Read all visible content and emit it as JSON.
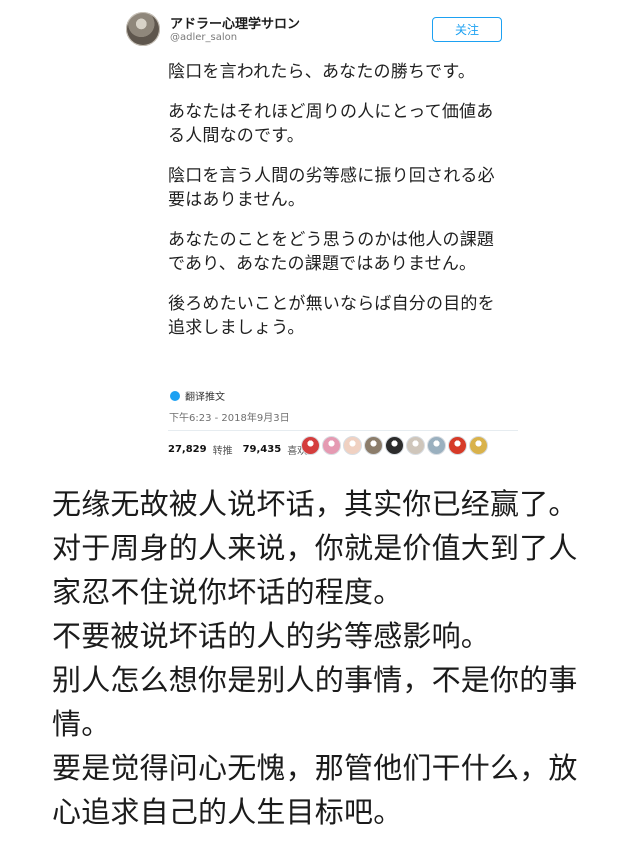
{
  "profile": {
    "display_name": "アドラー心理学サロン",
    "handle": "@adler_salon",
    "follow_label": "关注"
  },
  "tweet": {
    "paragraphs": [
      "陰口を言われたら、あなたの勝ちです。",
      "あなたはそれほど周りの人にとって価値ある人間なのです。",
      "陰口を言う人間の劣等感に振り回される必要はありません。",
      "あなたのことをどう思うのかは他人の課題であり、あなたの課題ではありません。",
      "後ろめたいことが無いならば自分の目的を追求しましょう。"
    ],
    "translate_label": "翻译推文",
    "timestamp": "下午6:23 - 2018年9月3日"
  },
  "stats": {
    "retweets_count": "27,829",
    "retweets_label": "转推",
    "likes_count": "79,435",
    "likes_label": "喜欢"
  },
  "liker_avatars": [
    {
      "icon": "liker-avatar-icon",
      "color": "#d43d3d"
    },
    {
      "icon": "liker-avatar-icon",
      "color": "#e59ab2"
    },
    {
      "icon": "liker-avatar-icon",
      "color": "#f0d1c2"
    },
    {
      "icon": "liker-avatar-icon",
      "color": "#8c7d6b"
    },
    {
      "icon": "liker-avatar-icon",
      "color": "#2b2b2b"
    },
    {
      "icon": "liker-avatar-icon",
      "color": "#cfc6bb"
    },
    {
      "icon": "liker-avatar-icon",
      "color": "#9ab0bf"
    },
    {
      "icon": "liker-avatar-icon",
      "color": "#d63a28"
    },
    {
      "icon": "liker-avatar-icon",
      "color": "#d9b24b"
    }
  ],
  "caption": {
    "lines": [
      "无缘无故被人说坏话，其实你已经赢了。",
      "对于周身的人来说，你就是价值大到了人",
      "家忍不住说你坏话的程度。",
      "不要被说坏话的人的劣等感影响。",
      "别人怎么想你是别人的事情，不是你的事",
      "情。",
      "要是觉得问心无愧，那管他们干什么，放",
      "心追求自己的人生目标吧。"
    ]
  }
}
